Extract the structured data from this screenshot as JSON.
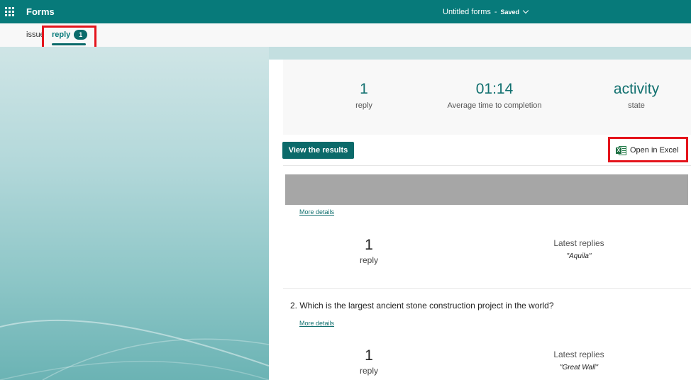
{
  "app": {
    "name": "Forms",
    "doc_title": "Untitled forms",
    "separator": "-",
    "save_status": "Saved"
  },
  "tabs": {
    "issue_label": "issue",
    "reply_label": "reply",
    "reply_count": "1"
  },
  "summary": {
    "replies_value": "1",
    "replies_label": "reply",
    "avg_time_value": "01:14",
    "avg_time_label": "Average time to completion",
    "state_value": "activity",
    "state_label": "state"
  },
  "actions": {
    "view_results_label": "View the results",
    "open_excel_label": "Open in Excel"
  },
  "questions": [
    {
      "title": "",
      "more_details_label": "More details",
      "reply_count": "1",
      "reply_label": "reply",
      "latest_label": "Latest replies",
      "latest_value": "\"Aquila\""
    },
    {
      "title": "2.  Which is the largest ancient stone construction project in the world?",
      "more_details_label": "More details",
      "reply_count": "1",
      "reply_label": "reply",
      "latest_label": "Latest replies",
      "latest_value": "\"Great Wall\""
    }
  ],
  "colors": {
    "brand": "#077a7a",
    "accent_dark": "#0b6a6a",
    "highlight": "#e4141c"
  }
}
